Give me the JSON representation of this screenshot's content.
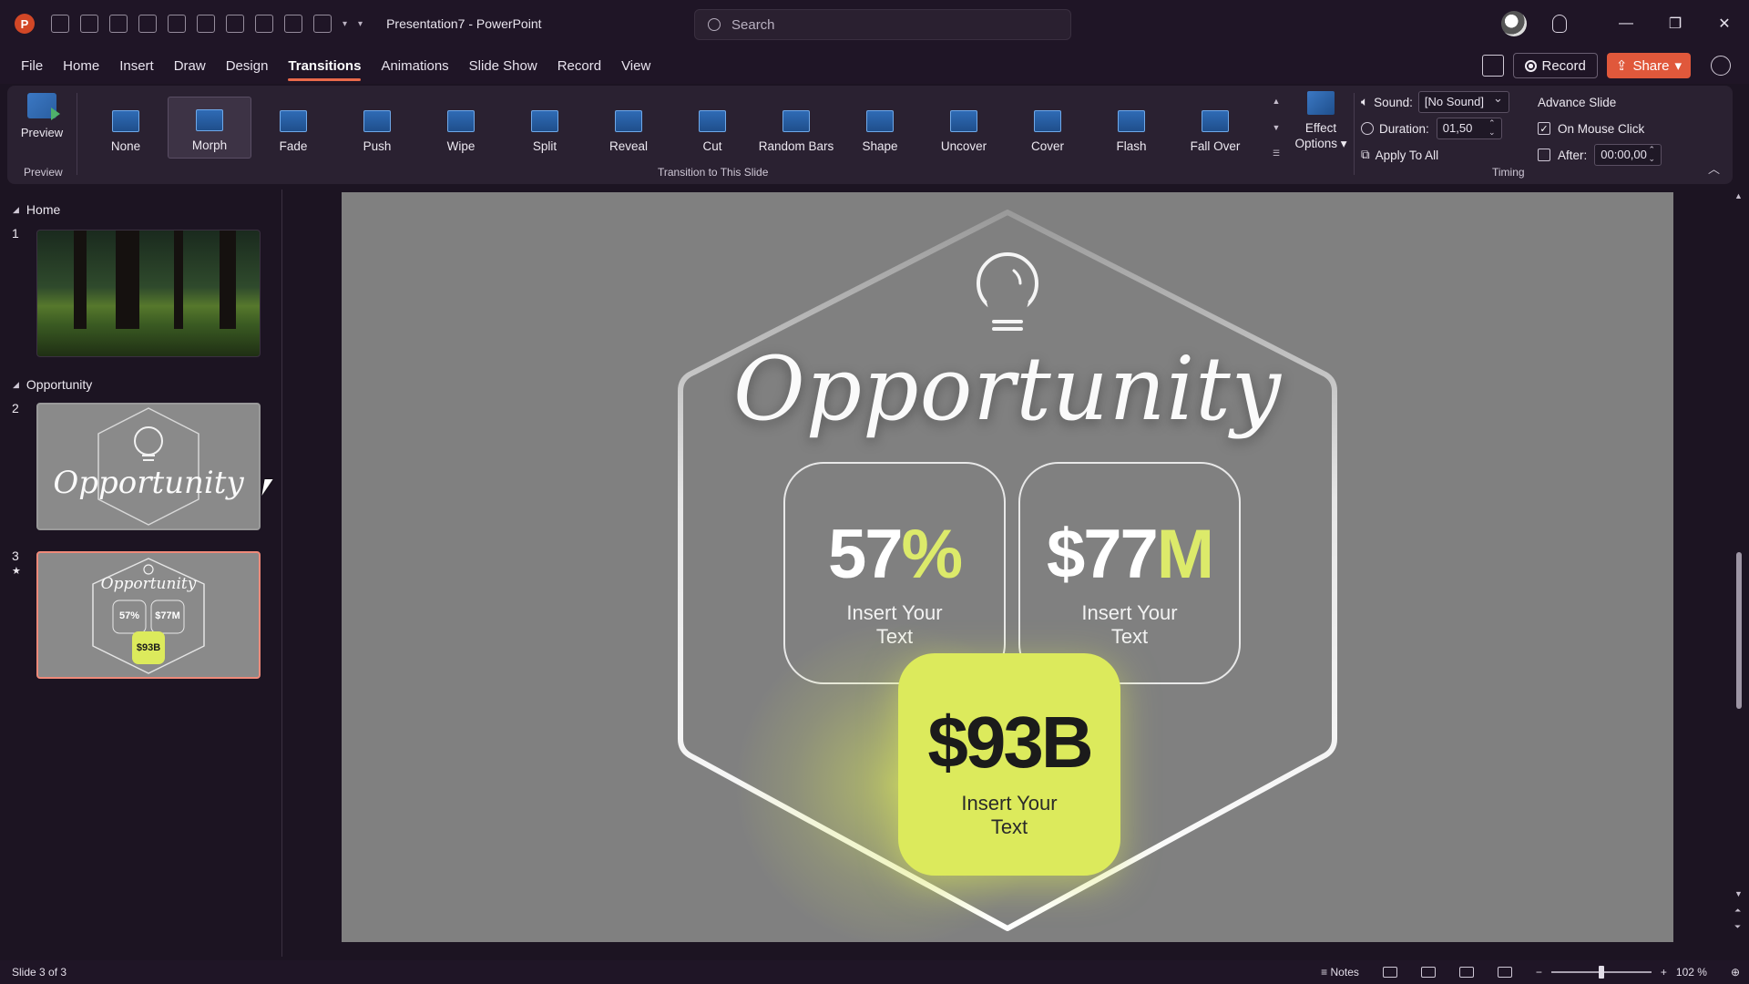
{
  "app": {
    "logo_letter": "P",
    "doc_title": "Presentation7  -  PowerPoint"
  },
  "search": {
    "placeholder": "Search"
  },
  "ribbon_tabs": [
    "File",
    "Home",
    "Insert",
    "Draw",
    "Design",
    "Transitions",
    "Animations",
    "Slide Show",
    "Record",
    "View"
  ],
  "active_tab": "Transitions",
  "header_actions": {
    "record_label": "Record",
    "share_label": "Share"
  },
  "preview_group": {
    "button_label": "Preview",
    "group_label": "Preview"
  },
  "transitions": {
    "group_label": "Transition to This Slide",
    "items": [
      "None",
      "Morph",
      "Fade",
      "Push",
      "Wipe",
      "Split",
      "Reveal",
      "Cut",
      "Random Bars",
      "Shape",
      "Uncover",
      "Cover",
      "Flash",
      "Fall Over"
    ],
    "selected": "Morph",
    "effect_options_label_1": "Effect",
    "effect_options_label_2": "Options"
  },
  "timing": {
    "group_label": "Timing",
    "sound_label": "Sound:",
    "sound_value": "[No Sound]",
    "duration_label": "Duration:",
    "duration_value": "01,50",
    "apply_all_label": "Apply To All",
    "advance_title": "Advance Slide",
    "on_mouse_click_label": "On Mouse Click",
    "on_mouse_click_checked": true,
    "after_label": "After:",
    "after_value": "00:00,00",
    "after_checked": false
  },
  "thumbnails": {
    "sections": [
      {
        "name": "Home"
      },
      {
        "name": "Opportunity"
      }
    ],
    "slides": [
      {
        "number": "1"
      },
      {
        "number": "2",
        "title": "Opportunity"
      },
      {
        "number": "3",
        "title": "Opportunity",
        "stat1": "57%",
        "stat2": "$77M",
        "stat3": "$93B",
        "has_transition": true
      }
    ],
    "transition_marker": "★"
  },
  "slide": {
    "title": "Opportunity",
    "cards": [
      {
        "value_main": "57",
        "value_accent": "%",
        "text_line1": "Insert Your",
        "text_line2": "Text"
      },
      {
        "value_main": "$77",
        "value_accent": "M",
        "text_line1": "Insert Your",
        "text_line2": "Text"
      },
      {
        "value_main": "$93B",
        "text_line1": "Insert Your",
        "text_line2": "Text"
      }
    ]
  },
  "status": {
    "slide_counter": "Slide 3 of 3",
    "notes_label": "Notes",
    "zoom_level": "102 %"
  },
  "colors": {
    "accent": "#dcea5c",
    "share": "#e0583b",
    "active_tab_underline": "#e9694a",
    "slide_bg": "#808080"
  }
}
